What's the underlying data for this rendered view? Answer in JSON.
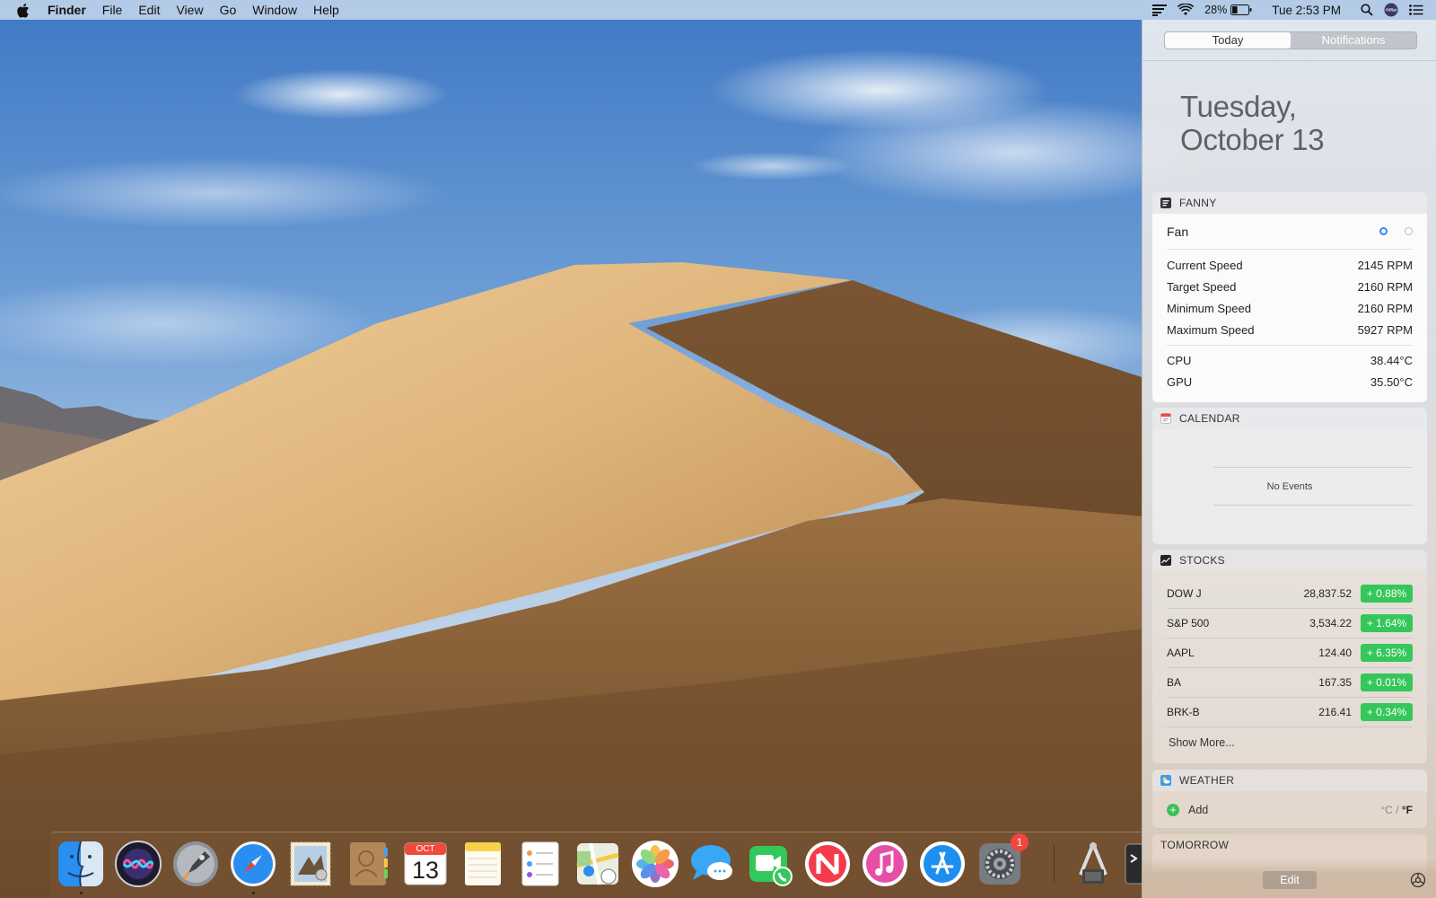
{
  "menubar": {
    "app_name": "Finder",
    "menus": [
      "File",
      "Edit",
      "View",
      "Go",
      "Window",
      "Help"
    ],
    "battery_percent": "28%",
    "clock": "Tue 2:53 PM",
    "icons": [
      "apple-logo",
      "fanny-menu-icon",
      "wifi-icon",
      "battery-icon",
      "spotlight-icon",
      "siri-icon",
      "notification-center-icon"
    ]
  },
  "notification_center": {
    "tabs": [
      {
        "label": "Today",
        "active": true
      },
      {
        "label": "Notifications",
        "active": false
      }
    ],
    "date_line1": "Tuesday,",
    "date_line2": "October 13",
    "fanny": {
      "title": "FANNY",
      "fan_label": "Fan",
      "rows": [
        {
          "label": "Current Speed",
          "value": "2145 RPM"
        },
        {
          "label": "Target Speed",
          "value": "2160 RPM"
        },
        {
          "label": "Minimum Speed",
          "value": "2160 RPM"
        },
        {
          "label": "Maximum Speed",
          "value": "5927 RPM"
        }
      ],
      "temps": [
        {
          "label": "CPU",
          "value": "38.44°C"
        },
        {
          "label": "GPU",
          "value": "35.50°C"
        }
      ]
    },
    "calendar": {
      "title": "CALENDAR",
      "empty_text": "No Events"
    },
    "stocks": {
      "title": "STOCKS",
      "rows": [
        {
          "symbol": "DOW J",
          "price": "28,837.52",
          "change": "+ 0.88%"
        },
        {
          "symbol": "S&P 500",
          "price": "3,534.22",
          "change": "+ 1.64%"
        },
        {
          "symbol": "AAPL",
          "price": "124.40",
          "change": "+ 6.35%"
        },
        {
          "symbol": "BA",
          "price": "167.35",
          "change": "+ 0.01%"
        },
        {
          "symbol": "BRK-B",
          "price": "216.41",
          "change": "+ 0.34%"
        }
      ],
      "show_more": "Show More..."
    },
    "weather": {
      "title": "WEATHER",
      "add_label": "Add",
      "unit_c": "°C",
      "unit_sep": "/",
      "unit_f": "°F"
    },
    "tomorrow": {
      "title": "TOMORROW"
    },
    "edit_label": "Edit"
  },
  "dock": {
    "apps": [
      "finder",
      "siri",
      "launchpad",
      "safari",
      "mail",
      "contacts",
      "calendar",
      "notes",
      "reminders",
      "maps",
      "photos",
      "messages",
      "facetime",
      "news",
      "itunes",
      "app-store",
      "system-preferences",
      "screenshot-utility",
      "terminal"
    ],
    "calendar_icon_month": "OCT",
    "calendar_icon_day": "13",
    "system_preferences_badge": "1"
  },
  "colors": {
    "stock_up": "#35c759",
    "accent": "#2f87f0",
    "badge": "#f2453d"
  }
}
